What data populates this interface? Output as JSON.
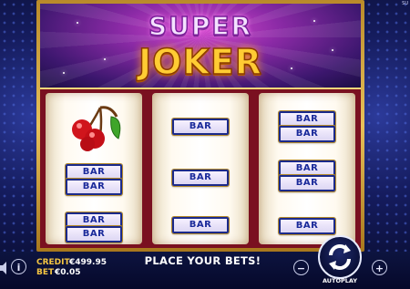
{
  "logo": {
    "line1": "SUPER",
    "line2": "JOKER"
  },
  "corner_label": "SU",
  "reels": [
    {
      "name": "reel-1",
      "symbols": [
        "cherry",
        "BAR",
        "BAR",
        "BAR",
        "BAR"
      ]
    },
    {
      "name": "reel-2",
      "symbols": [
        "BAR",
        "BAR",
        "BAR"
      ]
    },
    {
      "name": "reel-3",
      "symbols": [
        "BAR",
        "BAR",
        "BAR",
        "BAR",
        "BAR"
      ]
    }
  ],
  "bar_label": "BAR",
  "status": {
    "credit_label": "CREDIT",
    "credit_value": "€499.95",
    "bet_label": "BET",
    "bet_value": "€0.05",
    "message": "PLACE YOUR BETS!"
  },
  "controls": {
    "minus": "−",
    "plus": "+",
    "autoplay_label": "AUTOPLAY",
    "info": "i"
  },
  "colors": {
    "accent_gold": "#f5c542",
    "bar_blue": "#1a2a9a",
    "logo_purple": "#8b2aa6"
  },
  "icons": [
    "speaker-icon",
    "info-icon",
    "minus-icon",
    "plus-icon",
    "spin-arrows-icon",
    "cherry-icon"
  ]
}
